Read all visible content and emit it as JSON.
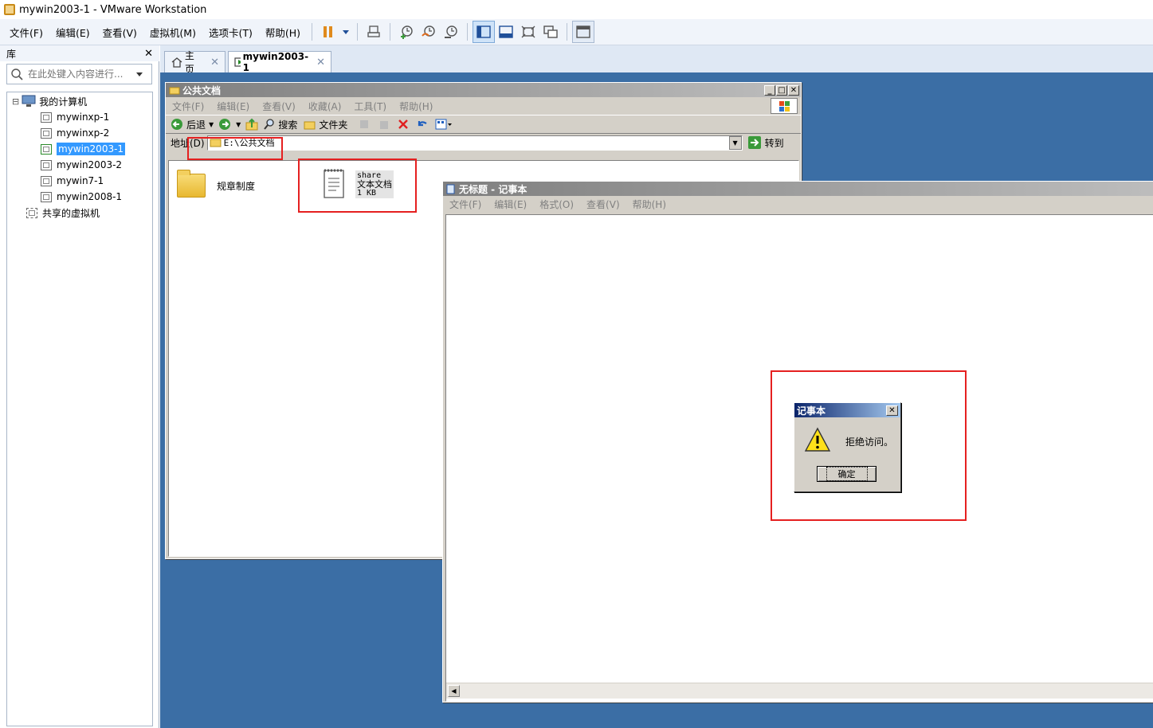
{
  "window": {
    "title": "mywin2003-1 - VMware Workstation"
  },
  "menu": [
    "文件(F)",
    "编辑(E)",
    "查看(V)",
    "虚拟机(M)",
    "选项卡(T)",
    "帮助(H)"
  ],
  "library": {
    "title": "库",
    "close": "✕",
    "search_placeholder": "在此处键入内容进行...",
    "root": "我的计算机",
    "vms": [
      "mywinxp-1",
      "mywinxp-2",
      "mywin2003-1",
      "mywin2003-2",
      "mywin7-1",
      "mywin2008-1"
    ],
    "selected": "mywin2003-1",
    "shared": "共享的虚拟机",
    "collapse": "⊟"
  },
  "tabs": [
    {
      "label": "主页",
      "close": "✕"
    },
    {
      "label": "mywin2003-1",
      "close": "✕"
    }
  ],
  "explorer": {
    "title": "公共文档",
    "menu": [
      "文件(F)",
      "编辑(E)",
      "查看(V)",
      "收藏(A)",
      "工具(T)",
      "帮助(H)"
    ],
    "back": "后退",
    "search": "搜索",
    "folders": "文件夹",
    "address_label": "地址(D)",
    "address": "E:\\公共文档",
    "go": "转到",
    "items": [
      {
        "name": "规章制度"
      },
      {
        "name": "share",
        "type": "文本文档",
        "size": "1 KB"
      }
    ]
  },
  "notepad": {
    "title": "无标题 - 记事本",
    "menu": [
      "文件(F)",
      "编辑(E)",
      "格式(O)",
      "查看(V)",
      "帮助(H)"
    ]
  },
  "dialog": {
    "title": "记事本",
    "message": "拒绝访问。",
    "ok": "确定",
    "close": "✕"
  },
  "colors": {
    "vm_background": "#3b6ea5",
    "highlight": "#e52020",
    "selection": "#3399ff"
  }
}
